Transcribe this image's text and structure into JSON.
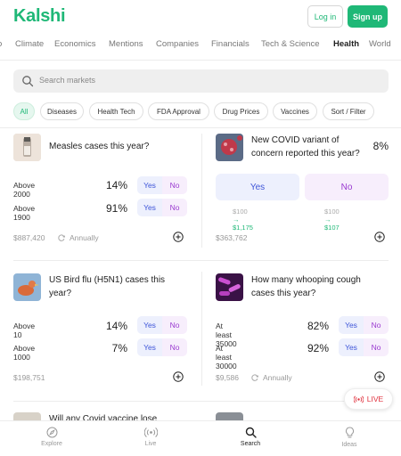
{
  "header": {
    "logo": "Kalshi",
    "login_label": "Log in",
    "signup_label": "Sign up"
  },
  "categories": [
    "o",
    "Climate",
    "Economics",
    "Mentions",
    "Companies",
    "Financials",
    "Tech & Science",
    "Health",
    "World"
  ],
  "active_category": "Health",
  "search": {
    "placeholder": "Search markets"
  },
  "chips": [
    "All",
    "Diseases",
    "Health Tech",
    "FDA Approval",
    "Drug Prices",
    "Vaccines",
    "Sort / Filter"
  ],
  "active_chip": "All",
  "markets": {
    "measles": {
      "title": "Measles cases this year?",
      "rows": [
        {
          "label": "Above 2000",
          "pct": "14%",
          "yes": "Yes",
          "no": "No"
        },
        {
          "label": "Above 1900",
          "pct": "91%",
          "yes": "Yes",
          "no": "No"
        }
      ],
      "volume": "$887,420",
      "frequency": "Annually"
    },
    "covid_variant": {
      "title": "New COVID variant of concern reported this year?",
      "pct": "8%",
      "yes": "Yes",
      "no": "No",
      "yes_payout_from": "$100",
      "yes_payout_to": "$1,175",
      "no_payout_from": "$100",
      "no_payout_to": "$107",
      "volume": "$363,762"
    },
    "bird_flu": {
      "title": "US Bird flu (H5N1) cases this year?",
      "rows": [
        {
          "label": "Above 10",
          "pct": "14%",
          "yes": "Yes",
          "no": "No"
        },
        {
          "label": "Above 1000",
          "pct": "7%",
          "yes": "Yes",
          "no": "No"
        }
      ],
      "volume": "$198,751"
    },
    "whooping_cough": {
      "title": "How many whooping cough cases this year?",
      "rows": [
        {
          "label": "At least 35000",
          "pct": "82%",
          "yes": "Yes",
          "no": "No"
        },
        {
          "label": "At least 30000",
          "pct": "92%",
          "yes": "Yes",
          "no": "No"
        }
      ],
      "volume": "$9,586",
      "frequency": "Annually"
    },
    "partial_left": {
      "title": "Will any Covid vaccine lose"
    }
  },
  "live_button": {
    "label": "LIVE"
  },
  "bottom_nav": {
    "explore": "Explore",
    "live": "Live",
    "search": "Search",
    "ideas": "Ideas"
  },
  "colors": {
    "brand": "#1fb877",
    "yes": "#3f56d9",
    "no": "#9a3ad0",
    "live": "#e0333f"
  }
}
